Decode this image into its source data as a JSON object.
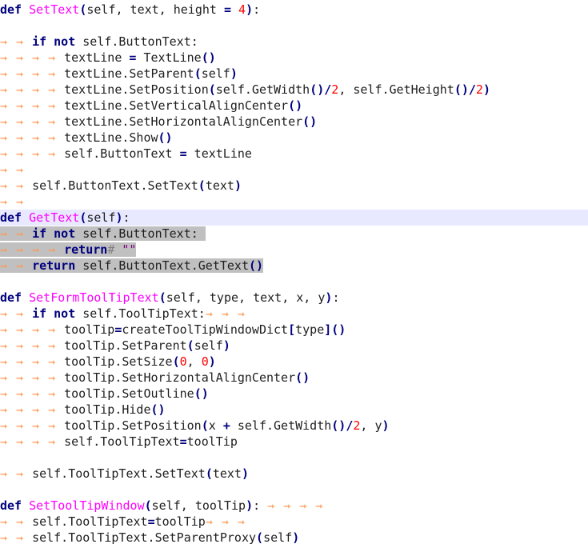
{
  "editor": {
    "lines": [
      {
        "text": "def SetText(self, text, height = 4):",
        "tokens": [
          [
            "kw",
            "def"
          ],
          [
            "id",
            " "
          ],
          [
            "fn",
            "SetText"
          ],
          [
            "op",
            "("
          ],
          [
            "id",
            "self, text, height "
          ],
          [
            "op",
            "="
          ],
          [
            "id",
            " "
          ],
          [
            "num",
            "4"
          ],
          [
            "op",
            ")"
          ],
          [
            "id",
            ":"
          ]
        ]
      },
      {
        "text": "",
        "tokens": []
      },
      {
        "text": "    if not self.ButtonText:",
        "tokens": [
          [
            "tab",
            "  "
          ],
          [
            "kw",
            "if"
          ],
          [
            "id",
            " "
          ],
          [
            "kw",
            "not"
          ],
          [
            "id",
            " self.ButtonText:"
          ]
        ]
      },
      {
        "text": "        textLine = TextLine()",
        "tokens": [
          [
            "tab",
            "    "
          ],
          [
            "id",
            "textLine "
          ],
          [
            "op",
            "="
          ],
          [
            "id",
            " TextLine"
          ],
          [
            "op",
            "()"
          ]
        ]
      },
      {
        "text": "        textLine.SetParent(self)",
        "tokens": [
          [
            "tab",
            "    "
          ],
          [
            "id",
            "textLine.SetParent"
          ],
          [
            "op",
            "("
          ],
          [
            "id",
            "self"
          ],
          [
            "op",
            ")"
          ]
        ]
      },
      {
        "text": "        textLine.SetPosition(self.GetWidth()/2, self.GetHeight()/2)",
        "tokens": [
          [
            "tab",
            "    "
          ],
          [
            "id",
            "textLine.SetPosition"
          ],
          [
            "op",
            "("
          ],
          [
            "id",
            "self.GetWidth"
          ],
          [
            "op",
            "()"
          ],
          [
            "op",
            "/"
          ],
          [
            "num",
            "2"
          ],
          [
            "id",
            ", self.GetHeight"
          ],
          [
            "op",
            "()"
          ],
          [
            "op",
            "/"
          ],
          [
            "num",
            "2"
          ],
          [
            "op",
            ")"
          ]
        ]
      },
      {
        "text": "        textLine.SetVerticalAlignCenter()",
        "tokens": [
          [
            "tab",
            "    "
          ],
          [
            "id",
            "textLine.SetVerticalAlignCenter"
          ],
          [
            "op",
            "()"
          ]
        ]
      },
      {
        "text": "        textLine.SetHorizontalAlignCenter()",
        "tokens": [
          [
            "tab",
            "    "
          ],
          [
            "id",
            "textLine.SetHorizontalAlignCenter"
          ],
          [
            "op",
            "()"
          ]
        ]
      },
      {
        "text": "        textLine.Show()",
        "tokens": [
          [
            "tab",
            "    "
          ],
          [
            "id",
            "textLine.Show"
          ],
          [
            "op",
            "()"
          ]
        ]
      },
      {
        "text": "        self.ButtonText = textLine",
        "tokens": [
          [
            "tab",
            "    "
          ],
          [
            "id",
            "self.ButtonText "
          ],
          [
            "op",
            "="
          ],
          [
            "id",
            " textLine"
          ]
        ]
      },
      {
        "text": "",
        "tokens": [
          [
            "tab",
            "  "
          ]
        ]
      },
      {
        "text": "    self.ButtonText.SetText(text)",
        "tokens": [
          [
            "tab",
            "  "
          ],
          [
            "id",
            "self.ButtonText.SetText"
          ],
          [
            "op",
            "("
          ],
          [
            "id",
            "text"
          ],
          [
            "op",
            ")"
          ]
        ]
      },
      {
        "text": "",
        "tokens": [
          [
            "tab",
            "  "
          ]
        ]
      },
      {
        "text": "def GetText(self):",
        "current": true,
        "tokens": [
          [
            "kw",
            "def"
          ],
          [
            "id",
            " "
          ],
          [
            "fn",
            "GetText"
          ],
          [
            "op",
            "("
          ],
          [
            "id",
            "self"
          ],
          [
            "op",
            ")"
          ],
          [
            "id",
            ": "
          ]
        ]
      },
      {
        "text": "    if not self.ButtonText:",
        "sel": true,
        "tokens": [
          [
            "tab",
            "  "
          ],
          [
            "kw",
            "if"
          ],
          [
            "id",
            " "
          ],
          [
            "kw",
            "not"
          ],
          [
            "id",
            " self.ButtonText: "
          ]
        ]
      },
      {
        "text": "        return\"\"",
        "sel": true,
        "tokens": [
          [
            "tab",
            "    "
          ],
          [
            "kw",
            "return"
          ],
          [
            "cm",
            "# "
          ],
          [
            "str",
            "\"\""
          ]
        ]
      },
      {
        "text": "    return self.ButtonText.GetText()",
        "sel": true,
        "tokens": [
          [
            "tab",
            "  "
          ],
          [
            "kw",
            "return"
          ],
          [
            "id",
            " self.ButtonText.GetText"
          ],
          [
            "op",
            "()"
          ]
        ]
      },
      {
        "text": "",
        "tokens": []
      },
      {
        "text": "def SetFormToolTipText(self, type, text, x, y):",
        "tokens": [
          [
            "kw",
            "def"
          ],
          [
            "id",
            " "
          ],
          [
            "fn",
            "SetFormToolTipText"
          ],
          [
            "op",
            "("
          ],
          [
            "id",
            "self, type, text, x, y"
          ],
          [
            "op",
            ")"
          ],
          [
            "id",
            ":"
          ]
        ]
      },
      {
        "text": "    if not self.ToolTipText:",
        "tokens": [
          [
            "tab",
            "  "
          ],
          [
            "kw",
            "if"
          ],
          [
            "id",
            " "
          ],
          [
            "kw",
            "not"
          ],
          [
            "id",
            " self.ToolTipText:"
          ],
          [
            "tab",
            "   "
          ]
        ]
      },
      {
        "text": "        toolTip=createToolTipWindowDict[type]()",
        "tokens": [
          [
            "tab",
            "    "
          ],
          [
            "id",
            "toolTip"
          ],
          [
            "op",
            "="
          ],
          [
            "id",
            "createToolTipWindowDict"
          ],
          [
            "op",
            "["
          ],
          [
            "id",
            "type"
          ],
          [
            "op",
            "]"
          ],
          [
            "op",
            "()"
          ]
        ]
      },
      {
        "text": "        toolTip.SetParent(self)",
        "tokens": [
          [
            "tab",
            "    "
          ],
          [
            "id",
            "toolTip.SetParent"
          ],
          [
            "op",
            "("
          ],
          [
            "id",
            "self"
          ],
          [
            "op",
            ")"
          ]
        ]
      },
      {
        "text": "        toolTip.SetSize(0, 0)",
        "tokens": [
          [
            "tab",
            "    "
          ],
          [
            "id",
            "toolTip.SetSize"
          ],
          [
            "op",
            "("
          ],
          [
            "num",
            "0"
          ],
          [
            "id",
            ", "
          ],
          [
            "num",
            "0"
          ],
          [
            "op",
            ")"
          ]
        ]
      },
      {
        "text": "        toolTip.SetHorizontalAlignCenter()",
        "tokens": [
          [
            "tab",
            "    "
          ],
          [
            "id",
            "toolTip.SetHorizontalAlignCenter"
          ],
          [
            "op",
            "()"
          ]
        ]
      },
      {
        "text": "        toolTip.SetOutline()",
        "tokens": [
          [
            "tab",
            "    "
          ],
          [
            "id",
            "toolTip.SetOutline"
          ],
          [
            "op",
            "()"
          ]
        ]
      },
      {
        "text": "        toolTip.Hide()",
        "tokens": [
          [
            "tab",
            "    "
          ],
          [
            "id",
            "toolTip.Hide"
          ],
          [
            "op",
            "()"
          ]
        ]
      },
      {
        "text": "        toolTip.SetPosition(x + self.GetWidth()/2, y)",
        "tokens": [
          [
            "tab",
            "    "
          ],
          [
            "id",
            "toolTip.SetPosition"
          ],
          [
            "op",
            "("
          ],
          [
            "id",
            "x "
          ],
          [
            "op",
            "+"
          ],
          [
            "id",
            " self.GetWidth"
          ],
          [
            "op",
            "()"
          ],
          [
            "op",
            "/"
          ],
          [
            "num",
            "2"
          ],
          [
            "id",
            ", y"
          ],
          [
            "op",
            ")"
          ]
        ]
      },
      {
        "text": "        self.ToolTipText=toolTip",
        "tokens": [
          [
            "tab",
            "    "
          ],
          [
            "id",
            "self.ToolTipText"
          ],
          [
            "op",
            "="
          ],
          [
            "id",
            "toolTip"
          ]
        ]
      },
      {
        "text": "",
        "tokens": []
      },
      {
        "text": "    self.ToolTipText.SetText(text)",
        "tokens": [
          [
            "tab",
            "  "
          ],
          [
            "id",
            "self.ToolTipText.SetText"
          ],
          [
            "op",
            "("
          ],
          [
            "id",
            "text"
          ],
          [
            "op",
            ")"
          ]
        ]
      },
      {
        "text": "",
        "tokens": []
      },
      {
        "text": "def SetToolTipWindow(self, toolTip):",
        "tokens": [
          [
            "kw",
            "def"
          ],
          [
            "id",
            " "
          ],
          [
            "fn",
            "SetToolTipWindow"
          ],
          [
            "op",
            "("
          ],
          [
            "id",
            "self, toolTip"
          ],
          [
            "op",
            ")"
          ],
          [
            "id",
            ": "
          ],
          [
            "tab",
            "    "
          ]
        ]
      },
      {
        "text": "    self.ToolTipText=toolTip",
        "tokens": [
          [
            "tab",
            "  "
          ],
          [
            "id",
            "self.ToolTipText"
          ],
          [
            "op",
            "="
          ],
          [
            "id",
            "toolTip"
          ],
          [
            "tab",
            "   "
          ]
        ]
      },
      {
        "text": "    self.ToolTipText.SetParentProxy(self)",
        "tokens": [
          [
            "tab",
            "  "
          ],
          [
            "id",
            "self.ToolTipText.SetParentProxy"
          ],
          [
            "op",
            "("
          ],
          [
            "id",
            "self"
          ],
          [
            "op",
            ")"
          ]
        ]
      }
    ]
  },
  "colors": {
    "background": "#ffffff",
    "keyword": "#00007f",
    "function_name": "#ff00ff",
    "number": "#ff0000",
    "string": "#7f007f",
    "whitespace_marker": "#ff9955",
    "selection": "#c0c0c0",
    "current_line": "#e8e8ff"
  }
}
